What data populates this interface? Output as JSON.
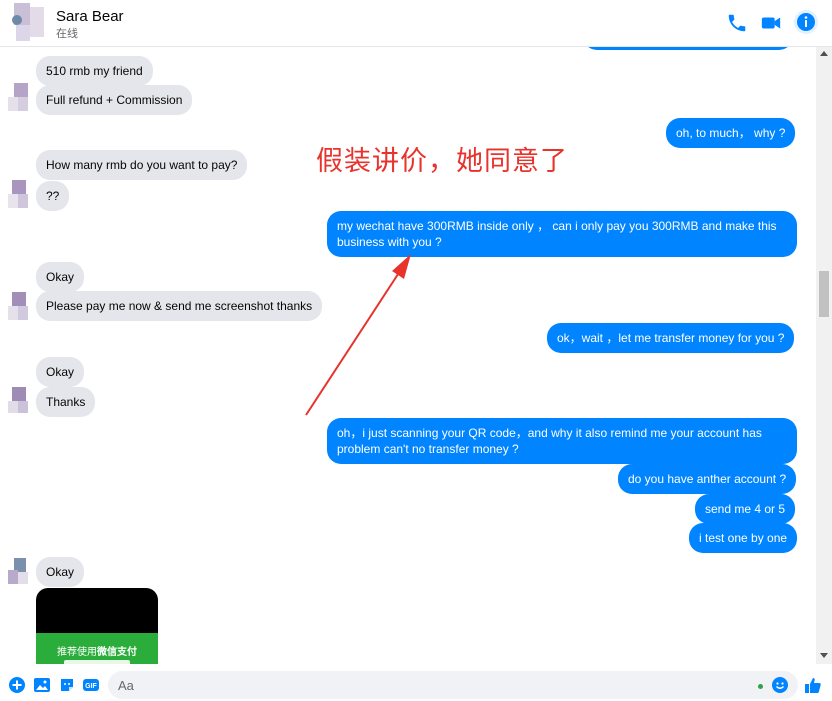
{
  "header": {
    "name": "Sara Bear",
    "status": "在线"
  },
  "annotation": "假装讲价，她同意了",
  "messages": {
    "m1": "510 rmb my friend",
    "m2": "Full refund + Commission",
    "m3": "oh, to much， why ?",
    "m4": "How many rmb do you want to pay?",
    "m5": "??",
    "m6": "my wechat have 300RMB inside only ， can i only pay you 300RMB and make this business with you ?",
    "m7": "Okay",
    "m8": "Please pay me now & send me screenshot thanks",
    "m9": "ok，wait ，let me transfer money for you ?",
    "m10": "Okay",
    "m11": "Thanks",
    "m12": "oh，i just scanning your QR code，and why it also remind me your account has problem can't no transfer money ?",
    "m13": "do you have anther account ?",
    "m14": "send me 4  or 5",
    "m15": "i test one by one",
    "m16": "Okay"
  },
  "image_text": {
    "prefix": "推荐使用",
    "bold": "微信支付"
  },
  "composer": {
    "placeholder": "Aa"
  },
  "colors": {
    "accent": "#0084ff",
    "incoming": "#e4e6eb",
    "annotation": "#e8332d"
  },
  "icons": [
    "phone-icon",
    "video-icon",
    "info-icon",
    "plus-icon",
    "photo-icon",
    "sticker-icon",
    "gif-icon",
    "emoji-icon",
    "thumbs-up-icon"
  ]
}
